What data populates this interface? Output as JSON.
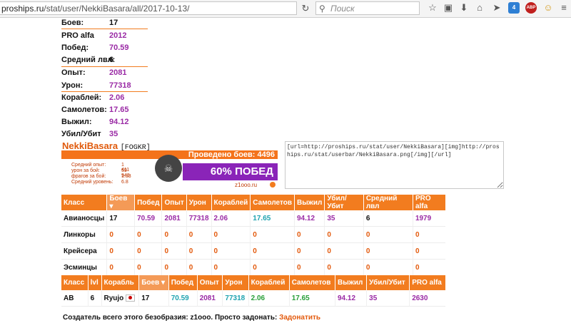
{
  "browser": {
    "url_host": "proships.ru",
    "url_path": "/stat/user/NekkiBasara/all/2017-10-13/",
    "search_placeholder": "Поиск",
    "ext_badge_1": "4",
    "ext_badge_2": "ABP"
  },
  "stats": [
    {
      "label": "Боев:",
      "value": "17",
      "color": "#111111"
    },
    {
      "label": "PRO alfa",
      "value": "2012",
      "color": "#9a2aa5"
    },
    {
      "label": "Побед:",
      "value": "70.59",
      "color": "#9a2aa5"
    },
    {
      "label": "Средний лвл:",
      "value": "6",
      "color": "#111111"
    },
    {
      "label": "Опыт:",
      "value": "2081",
      "color": "#9a2aa5"
    },
    {
      "label": "Урон:",
      "value": "77318",
      "color": "#9a2aa5"
    },
    {
      "label": "Кораблей:",
      "value": "2.06",
      "color": "#9a2aa5"
    },
    {
      "label": "Самолетов:",
      "value": "17.65",
      "color": "#9a2aa5"
    },
    {
      "label": "Выжил:",
      "value": "94.12",
      "color": "#9a2aa5"
    },
    {
      "label": "Убил/Убит",
      "value": "35",
      "color": "#9a2aa5"
    }
  ],
  "userbar": {
    "name": "NekkiBasara",
    "clan": "[FOGKR]",
    "battles_text": "Проведено боев: 4496",
    "win_text": "60% ПОБЕД",
    "site": "z1ooo.ru",
    "details": [
      {
        "label": "Средний опыт:",
        "value": "1 411"
      },
      {
        "label": "урон за бой:",
        "value": "59 943"
      },
      {
        "label": "фрагов за бой:",
        "value": "1.33"
      },
      {
        "label": "Средний уровень:",
        "value": "6.8"
      }
    ]
  },
  "bbcode": "[url=http://proships.ru/stat/user/NekkiBasara][img]http://proships.ru/stat/userbar/NekkiBasara.png[/img][/url]",
  "class_table": {
    "headers": [
      "Класс",
      "Боев ▾",
      "Побед",
      "Опыт",
      "Урон",
      "Кораблей",
      "Самолетов",
      "Выжил",
      "Убил/Убит",
      "Средний лвл",
      "PRO alfa"
    ],
    "rows": [
      [
        "Авианосцы",
        "17",
        "70.59",
        "2081",
        "77318",
        "2.06",
        "17.65",
        "94.12",
        "35",
        "6",
        "1979"
      ],
      [
        "Линкоры",
        "0",
        "0",
        "0",
        "0",
        "0",
        "0",
        "0",
        "0",
        "0",
        "0"
      ],
      [
        "Крейсера",
        "0",
        "0",
        "0",
        "0",
        "0",
        "0",
        "0",
        "0",
        "0",
        "0"
      ],
      [
        "Эсминцы",
        "0",
        "0",
        "0",
        "0",
        "0",
        "0",
        "0",
        "0",
        "0",
        "0"
      ]
    ]
  },
  "ship_table": {
    "headers": [
      "Класс",
      "lvl",
      "Корабль",
      "Боев ▾",
      "Побед",
      "Опыт",
      "Урон",
      "Кораблей",
      "Самолетов",
      "Выжил",
      "Убил/Убит",
      "PRO alfa"
    ],
    "rows": [
      [
        "AB",
        "6",
        "Ryujo",
        "17",
        "70.59",
        "2081",
        "77318",
        "2.06",
        "17.65",
        "94.12",
        "35",
        "2630"
      ]
    ]
  },
  "footer": {
    "text": "Создатель всего этого безобразия: z1ooo. Просто задонать: ",
    "link": "Задонатить"
  }
}
